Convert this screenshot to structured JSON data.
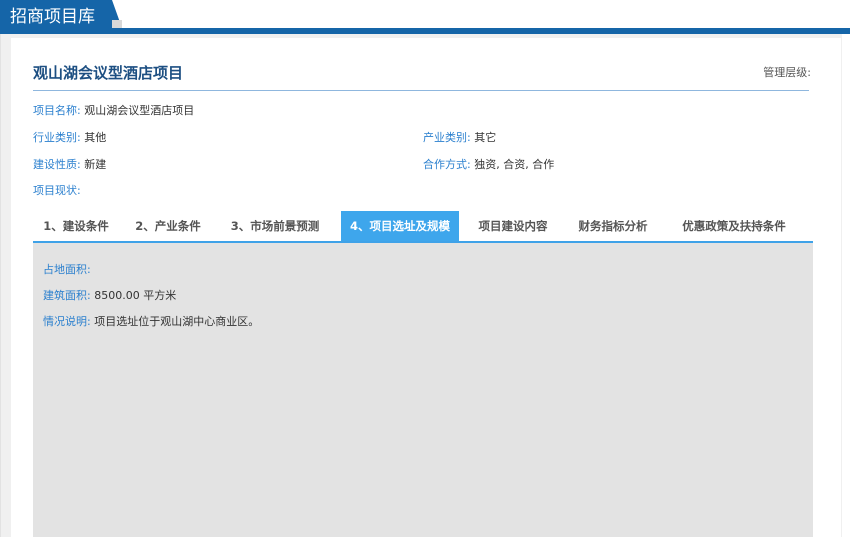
{
  "header": {
    "title": "招商项目库"
  },
  "project": {
    "title": "观山湖会议型酒店项目",
    "manage_label": "管理层级:",
    "fields": {
      "name": {
        "label": "项目名称:",
        "value": "观山湖会议型酒店项目"
      },
      "industry": {
        "label": "行业类别:",
        "value": "其他"
      },
      "sector": {
        "label": "产业类别:",
        "value": "其它"
      },
      "construction": {
        "label": "建设性质:",
        "value": "新建"
      },
      "cooperation": {
        "label": "合作方式:",
        "value": "独资, 合资, 合作"
      },
      "status": {
        "label": "项目现状:",
        "value": ""
      }
    }
  },
  "tabs": [
    {
      "label": "1、建设条件"
    },
    {
      "label": "2、产业条件"
    },
    {
      "label": "3、市场前景预测"
    },
    {
      "label": "4、项目选址及规模"
    },
    {
      "label": "项目建设内容"
    },
    {
      "label": "财务指标分析"
    },
    {
      "label": "优惠政策及扶持条件"
    }
  ],
  "active_tab": "4、项目选址及规模",
  "site": {
    "land_area": {
      "label": "占地面积:",
      "value": ""
    },
    "building_area": {
      "label": "建筑面积:",
      "value": "8500.00 平方米"
    },
    "description": {
      "label": "情况说明:",
      "value": "项目选址位于观山湖中心商业区。"
    }
  },
  "colors": {
    "brand": "#1565a8",
    "accent": "#3ea6ec",
    "label": "#2a7fce"
  }
}
